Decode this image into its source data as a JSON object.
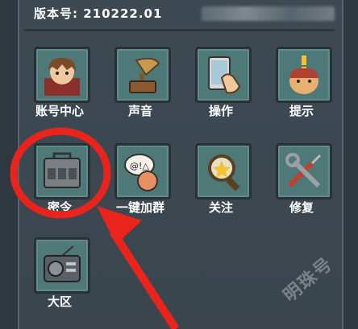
{
  "header": {
    "version_label": "版本号: 210222.01"
  },
  "menu": [
    {
      "label": "账号中心",
      "icon": "account-center-icon"
    },
    {
      "label": "声音",
      "icon": "gramophone-sound-icon"
    },
    {
      "label": "操作",
      "icon": "phone-tap-icon"
    },
    {
      "label": "提示",
      "icon": "hint-character-icon"
    },
    {
      "label": "密令",
      "icon": "code-box-icon"
    },
    {
      "label": "一键加群",
      "icon": "join-group-chat-icon"
    },
    {
      "label": "关注",
      "icon": "magnifier-follow-icon"
    },
    {
      "label": "修复",
      "icon": "wrench-screwdriver-icon"
    },
    {
      "label": "大区",
      "icon": "radio-region-icon"
    }
  ],
  "annotation": {
    "color": "#e8241c"
  },
  "watermark": "明珠号"
}
